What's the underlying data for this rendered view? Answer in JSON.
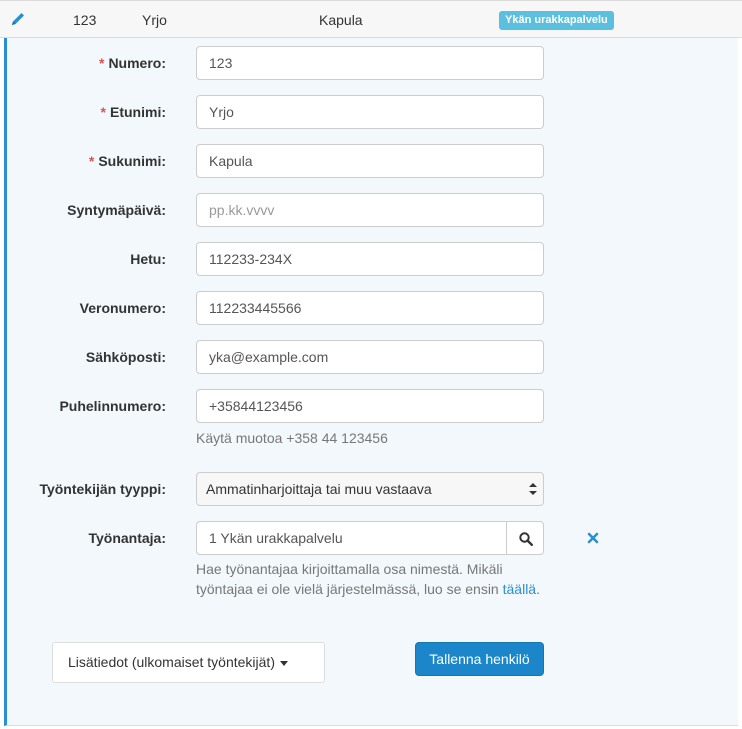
{
  "row": {
    "icon": "pencil-icon",
    "number": "123",
    "first_name": "Yrjo",
    "last_name": "Kapula",
    "badge": "Ykän urakkapalvelu",
    "badge_color": "#5bc0de"
  },
  "form": {
    "required_mark": "*",
    "fields": {
      "numero": {
        "label": "Numero:",
        "value": "123",
        "required": true
      },
      "etunimi": {
        "label": "Etunimi:",
        "value": "Yrjo",
        "required": true
      },
      "sukunimi": {
        "label": "Sukunimi:",
        "value": "Kapula",
        "required": true
      },
      "syntymapaiva": {
        "label": "Syntymäpäivä:",
        "value": "",
        "placeholder": "pp.kk.vvvv",
        "required": false
      },
      "hetu": {
        "label": "Hetu:",
        "value": "112233-234X",
        "required": false
      },
      "veronumero": {
        "label": "Veronumero:",
        "value": "112233445566",
        "required": false
      },
      "sahkoposti": {
        "label": "Sähköposti:",
        "value": "yka@example.com",
        "required": false
      },
      "puhelinnumero": {
        "label": "Puhelinnumero:",
        "value": "+35844123456",
        "help": "Käytä muotoa +358 44 123456",
        "required": false
      }
    },
    "tyontekijan_tyyppi": {
      "label": "Työntekijän tyyppi:",
      "selected": "Ammatinharjoittaja tai muu vastaava"
    },
    "tyonantaja": {
      "label": "Työnantaja:",
      "value": "1 Ykän urakkapalvelu",
      "help_text": "Hae työnantajaa kirjoittamalla osa nimestä. Mikäli työntajaa ei ole vielä järjestelmässä, luo se ensin",
      "help_link": "täällä",
      "help_end": ".",
      "search_icon": "search-icon",
      "clear_icon": "close-icon"
    },
    "lisatiedot_button": "Lisätiedot (ulkomaiset työntekijät)",
    "save_button": "Tallenna henkilö"
  },
  "colors": {
    "accent": "#2a8fd0",
    "primary_button": "#1b86c9",
    "required": "#d9534f",
    "panel_bg": "#f2f8fc"
  }
}
